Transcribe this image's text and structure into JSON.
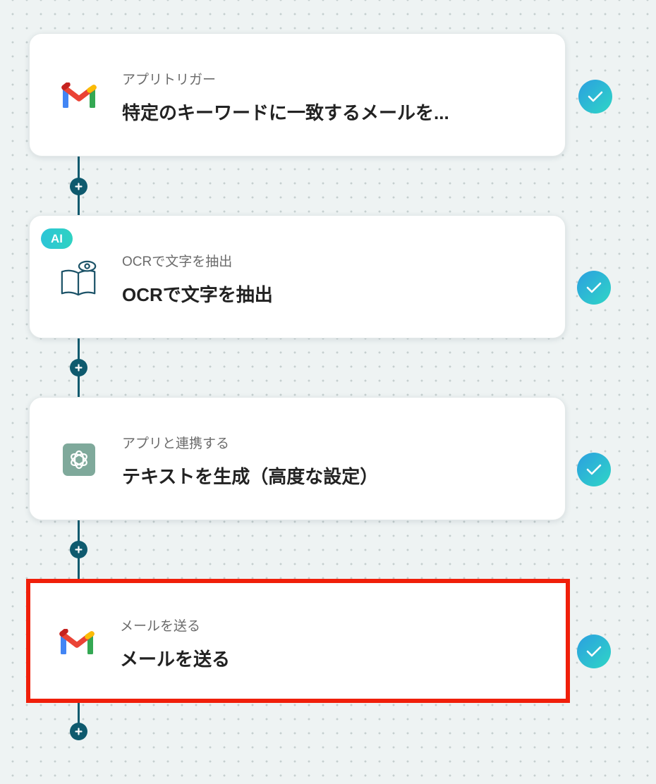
{
  "steps": [
    {
      "subtitle": "アプリトリガー",
      "title": "特定のキーワードに一致するメールを...",
      "icon": "gmail-icon",
      "ai_badge": null,
      "status": "completed"
    },
    {
      "subtitle": "OCRで文字を抽出",
      "title": "OCRで文字を抽出",
      "icon": "ocr-book-icon",
      "ai_badge": "AI",
      "status": "completed"
    },
    {
      "subtitle": "アプリと連携する",
      "title": "テキストを生成（高度な設定）",
      "icon": "chatgpt-icon",
      "ai_badge": null,
      "status": "completed"
    },
    {
      "subtitle": "メールを送る",
      "title": "メールを送る",
      "icon": "gmail-icon",
      "ai_badge": null,
      "status": "completed",
      "highlighted": true
    }
  ],
  "colors": {
    "connector": "#0e5a6e",
    "check_start": "#2b9fe0",
    "check_end": "#2fd6c6",
    "highlight_border": "#f01f0a",
    "ai_badge": "#2cc5d7",
    "chatgpt_tile": "#7fa99b"
  }
}
